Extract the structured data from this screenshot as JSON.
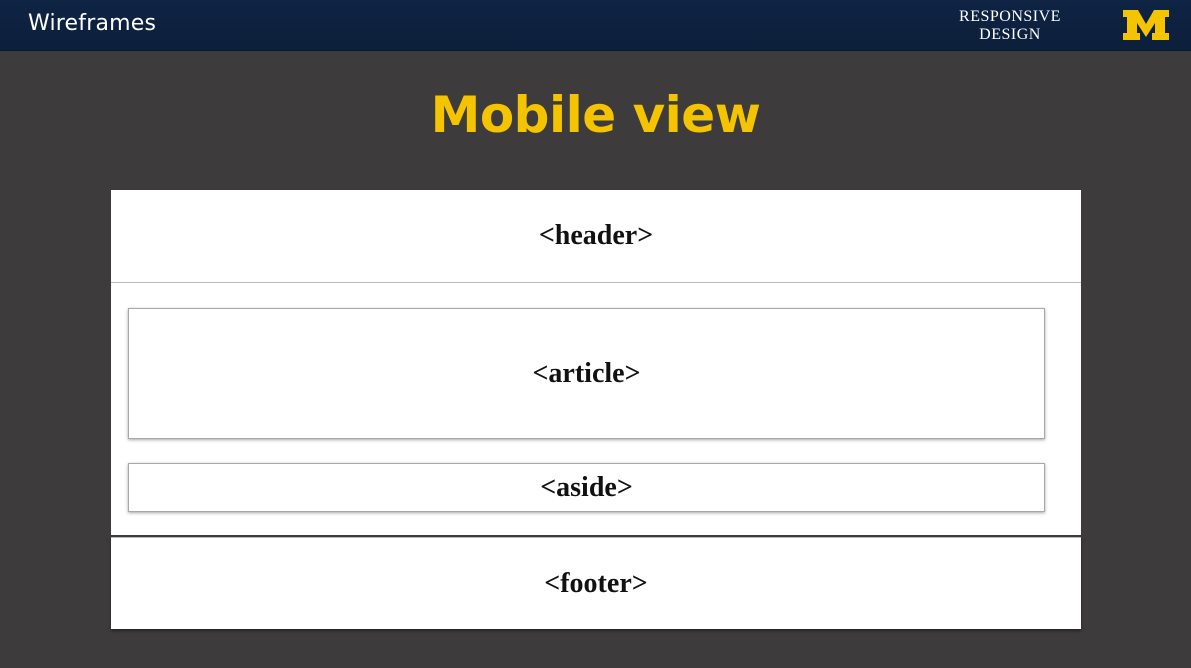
{
  "header": {
    "title": "Wireframes",
    "brand_line1": "RESPONSIVE",
    "brand_line2": "DESIGN",
    "logo_icon": "block-m-logo",
    "accent_color": "#f5c400",
    "bar_color": "#0f2444"
  },
  "slide": {
    "title": "Mobile view",
    "background_color": "#3d3b3c"
  },
  "wireframe": {
    "header_label": "<header>",
    "article_label": "<article>",
    "aside_label": "<aside>",
    "footer_label": "<footer>"
  }
}
